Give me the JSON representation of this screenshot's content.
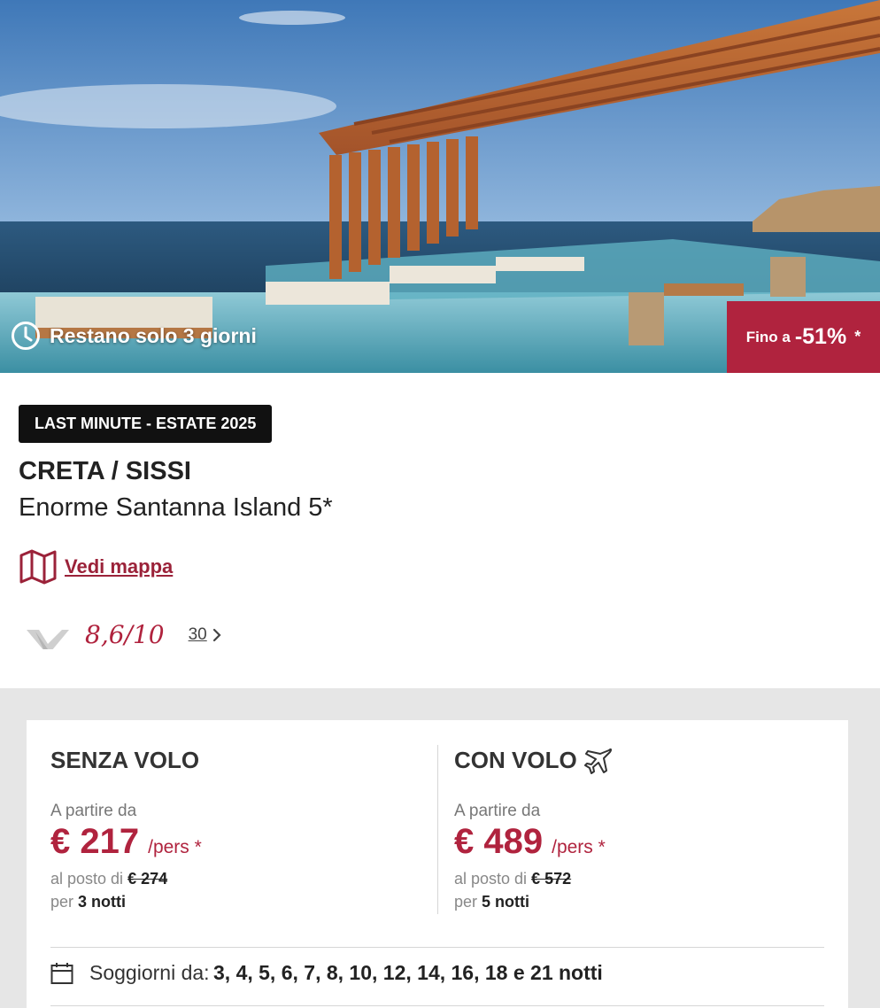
{
  "hero": {
    "countdown": "Restano solo 3 giorni",
    "discount_prefix": "Fino a",
    "discount_value": "-51%",
    "discount_note": "*"
  },
  "offer": {
    "tag": "LAST MINUTE - ESTATE 2025",
    "destination": "CRETA / SISSI",
    "hotel": "Enorme Santanna Island 5*",
    "map_link": "Vedi mappa",
    "rating_score": "8,6/10",
    "review_count": "30"
  },
  "prices": {
    "without_flight": {
      "title": "SENZA VOLO",
      "from_label": "A partire da",
      "price": "€ 217",
      "unit": "/pers *",
      "instead_label": "al posto di",
      "old_price": "€ 274",
      "per_label": "per",
      "nights": "3 notti"
    },
    "with_flight": {
      "title": "CON VOLO",
      "from_label": "A partire da",
      "price": "€ 489",
      "unit": "/pers *",
      "instead_label": "al posto di",
      "old_price": "€ 572",
      "per_label": "per",
      "nights": "5 notti"
    }
  },
  "stays": {
    "label": "Soggiorni da:",
    "values": "3, 4, 5, 6, 7, 8, 10, 12, 14, 16, 18 e 21 notti"
  },
  "colors": {
    "accent": "#b0233e",
    "link": "#9b2239",
    "tag_bg": "#111111",
    "section_bg": "#e6e6e6"
  },
  "icons": [
    "clock-icon",
    "map-icon",
    "reviews-logo-icon",
    "chevron-right-icon",
    "airplane-icon",
    "calendar-icon"
  ]
}
